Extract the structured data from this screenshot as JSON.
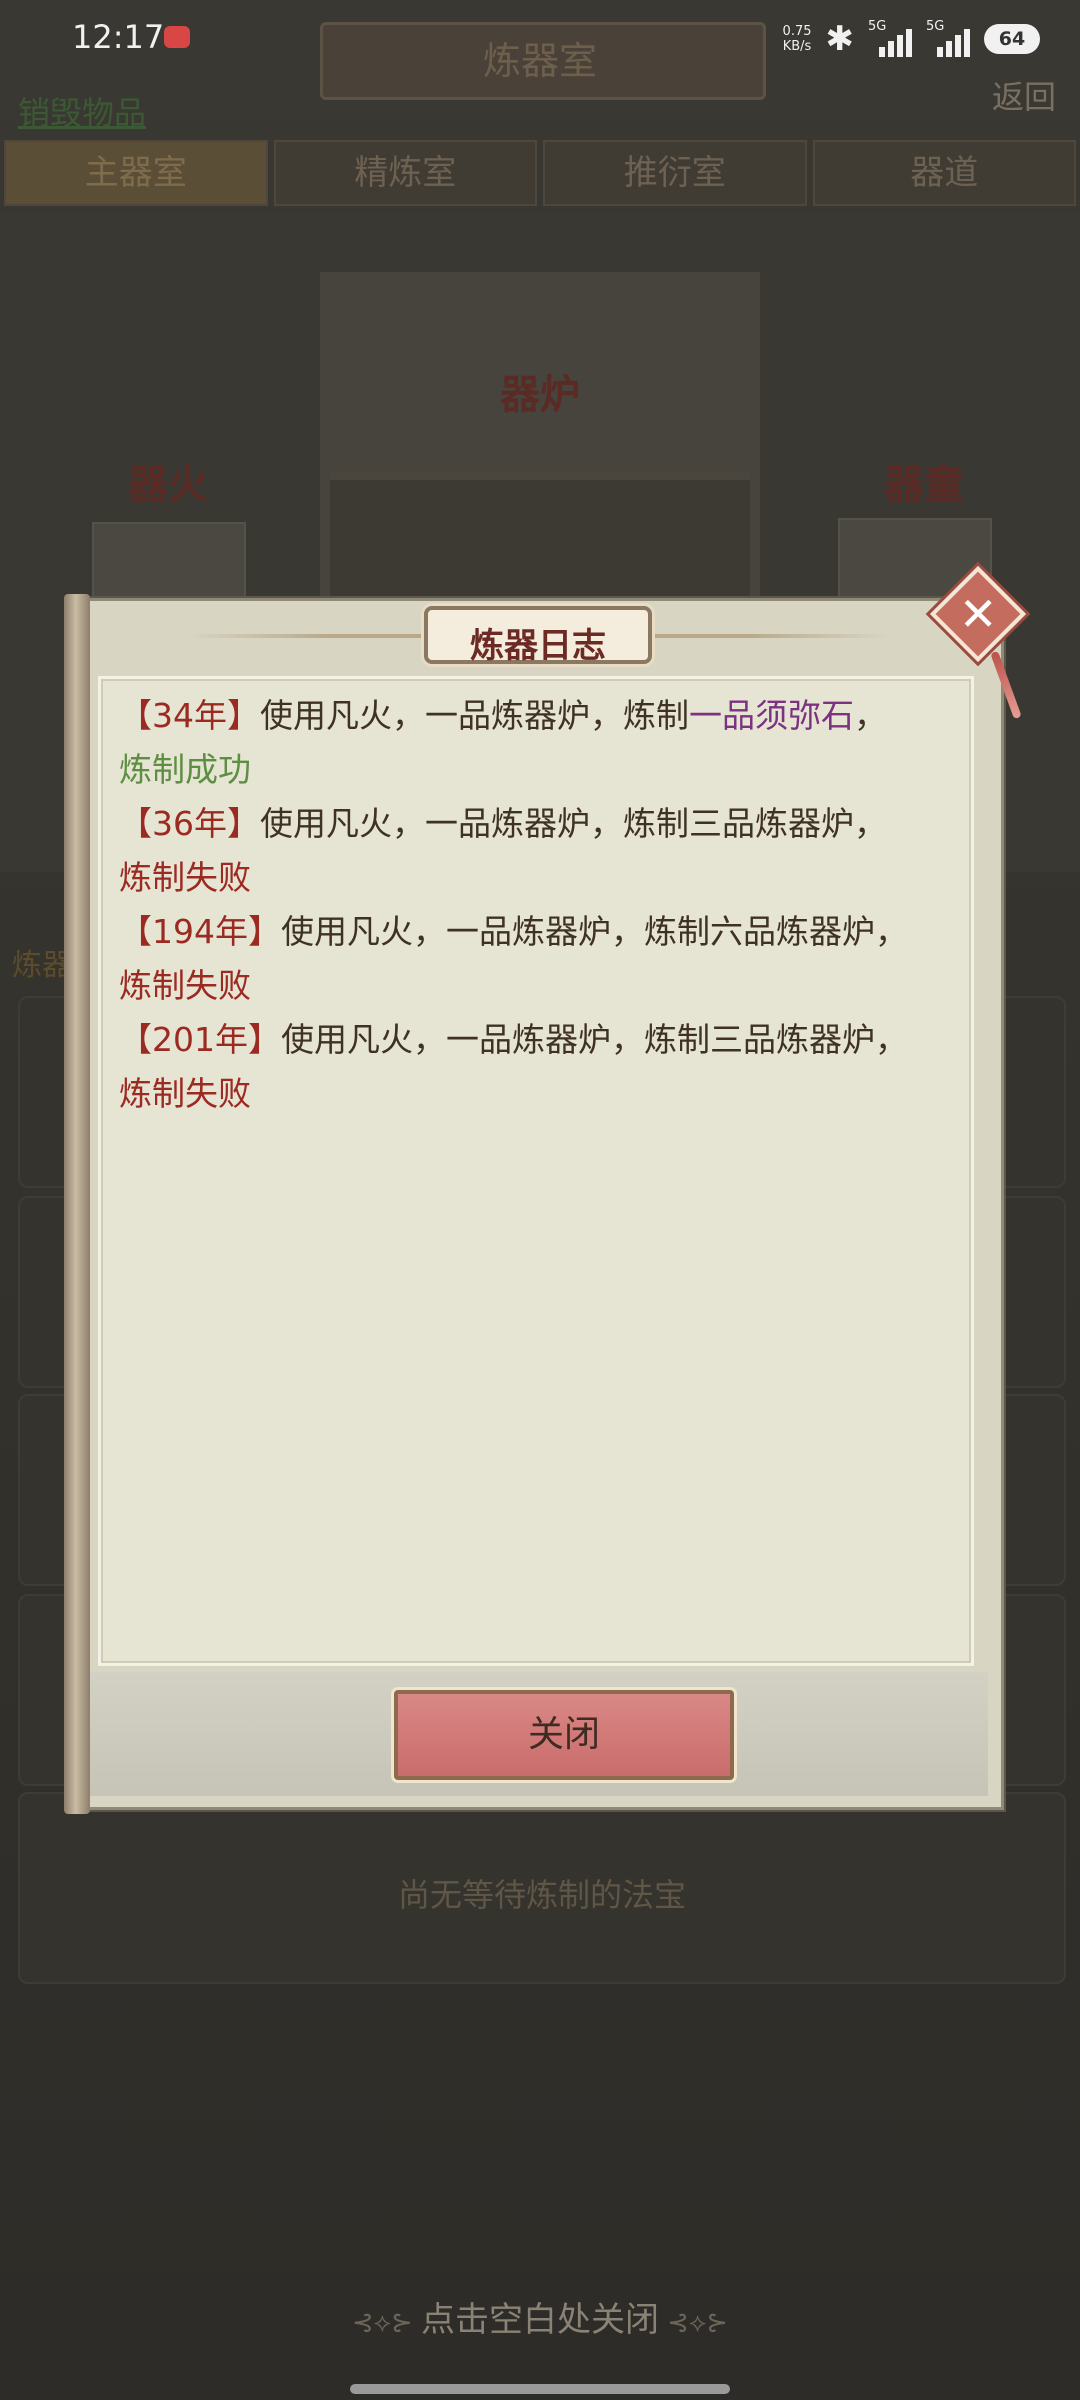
{
  "status_bar": {
    "time": "12:17",
    "net_speed_value": "0.75",
    "net_speed_unit": "KB/s",
    "sim1_label": "5G",
    "sim2_label": "5G",
    "battery": "64"
  },
  "screen": {
    "title": "炼器室",
    "back": "返回",
    "destroy_items": "销毁物品",
    "tabs": [
      "主器室",
      "精炼室",
      "推衍室",
      "器道"
    ],
    "stage_labels": {
      "furnace": "器炉",
      "fire": "器火",
      "boy": "器童"
    },
    "craft_label": "炼器",
    "empty_queue": "尚无等待炼制的法宝",
    "tap_to_close": "点击空白处关闭"
  },
  "dialog": {
    "title": "炼器日志",
    "entries": [
      {
        "year": "34年",
        "text": "使用凡火，一品炼器炉，炼制",
        "item": "一品须弥石",
        "sep": "，",
        "result": "炼制成功"
      },
      {
        "year": "36年",
        "text": "使用凡火，一品炼器炉，炼制三品炼器炉，",
        "result": "炼制失败"
      },
      {
        "year": "194年",
        "text": "使用凡火，一品炼器炉，炼制六品炼器炉，",
        "result": "炼制失败"
      },
      {
        "year": "201年",
        "text": "使用凡火，一品炼器炉，炼制三品炼器炉，",
        "result": "炼制失败"
      }
    ],
    "close_button": "关闭"
  }
}
